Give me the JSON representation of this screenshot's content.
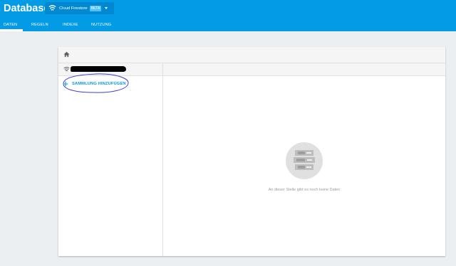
{
  "app": {
    "title": "Database"
  },
  "db_selector": {
    "name": "Cloud Firestore",
    "badge": "BETA",
    "wifi_icon": "firestore-icon",
    "caret_icon": "caret-down-icon"
  },
  "tabs": [
    {
      "label": "DATEN",
      "active": true
    },
    {
      "label": "REGELN",
      "active": false
    },
    {
      "label": "INDEXE",
      "active": false
    },
    {
      "label": "NUTZUNG",
      "active": false
    }
  ],
  "panel": {
    "home_icon": "home-icon",
    "project_icon": "firestore-icon",
    "add_collection_label": "SAMMLUNG HINZUFÜGEN",
    "add_icon": "plus-icon",
    "empty_message": "An dieser Stelle gibt es noch keine Daten",
    "empty_icon": "database-empty-icon"
  },
  "colors": {
    "primary": "#039be5",
    "selector_bg": "#0288d1",
    "annotation": "#3f3fd8",
    "page_bg": "#eceff1"
  }
}
